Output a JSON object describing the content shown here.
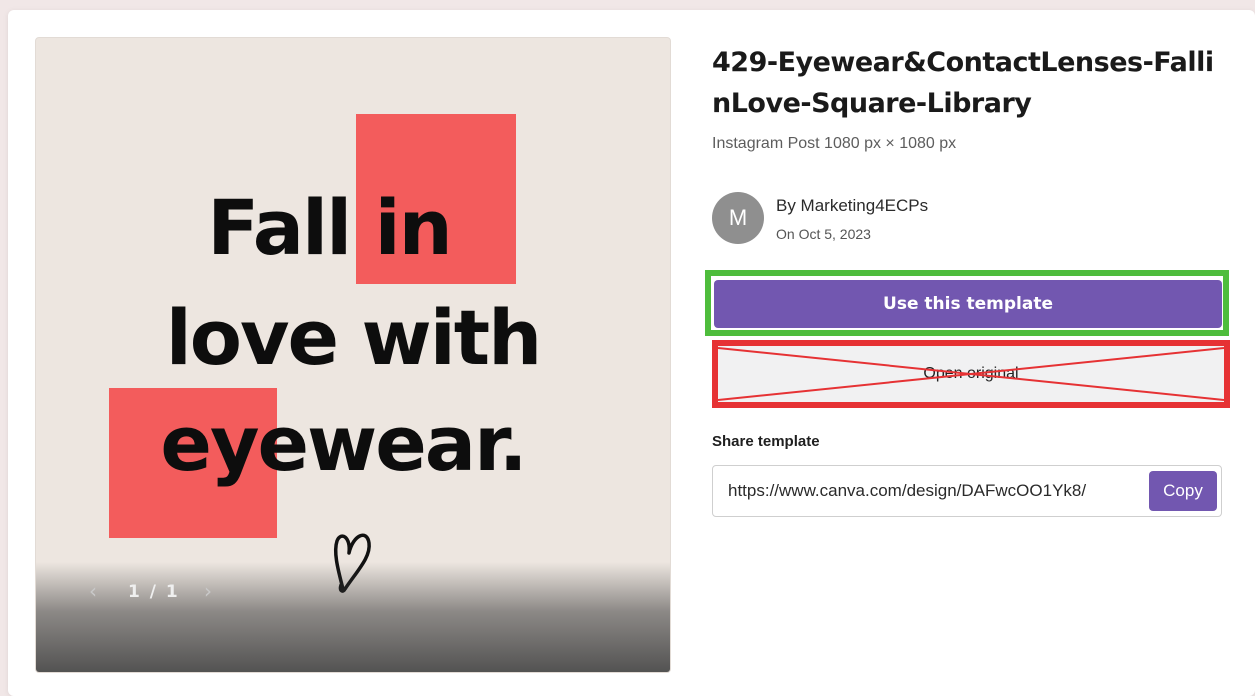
{
  "template": {
    "title": "429-Eyewear&ContactLenses-FallinLove-Square-Library",
    "subtitle": "Instagram Post 1080 px × 1080 px",
    "author": {
      "avatar_initial": "M",
      "by_line": "By Marketing4ECPs",
      "date_line": "On Oct 5, 2023"
    }
  },
  "preview": {
    "headline_lines": [
      "Fall in",
      "love with",
      "eyewear."
    ],
    "pager": "1 / 1",
    "prev_icon": "chevron-left-icon",
    "next_icon": "chevron-right-icon",
    "decorative_icon": "heart-icon"
  },
  "actions": {
    "use_template_label": "Use this template",
    "open_original_label": "Open original"
  },
  "share": {
    "label": "Share template",
    "url": "https://www.canva.com/design/DAFwcOO1Yk8/",
    "copy_label": "Copy"
  },
  "colors": {
    "brand_purple": "#7257b0",
    "accent_red_block": "#f35c5c",
    "highlight_green": "#4ebd3c",
    "highlight_red": "#e63234",
    "preview_background": "#ede6e0"
  }
}
